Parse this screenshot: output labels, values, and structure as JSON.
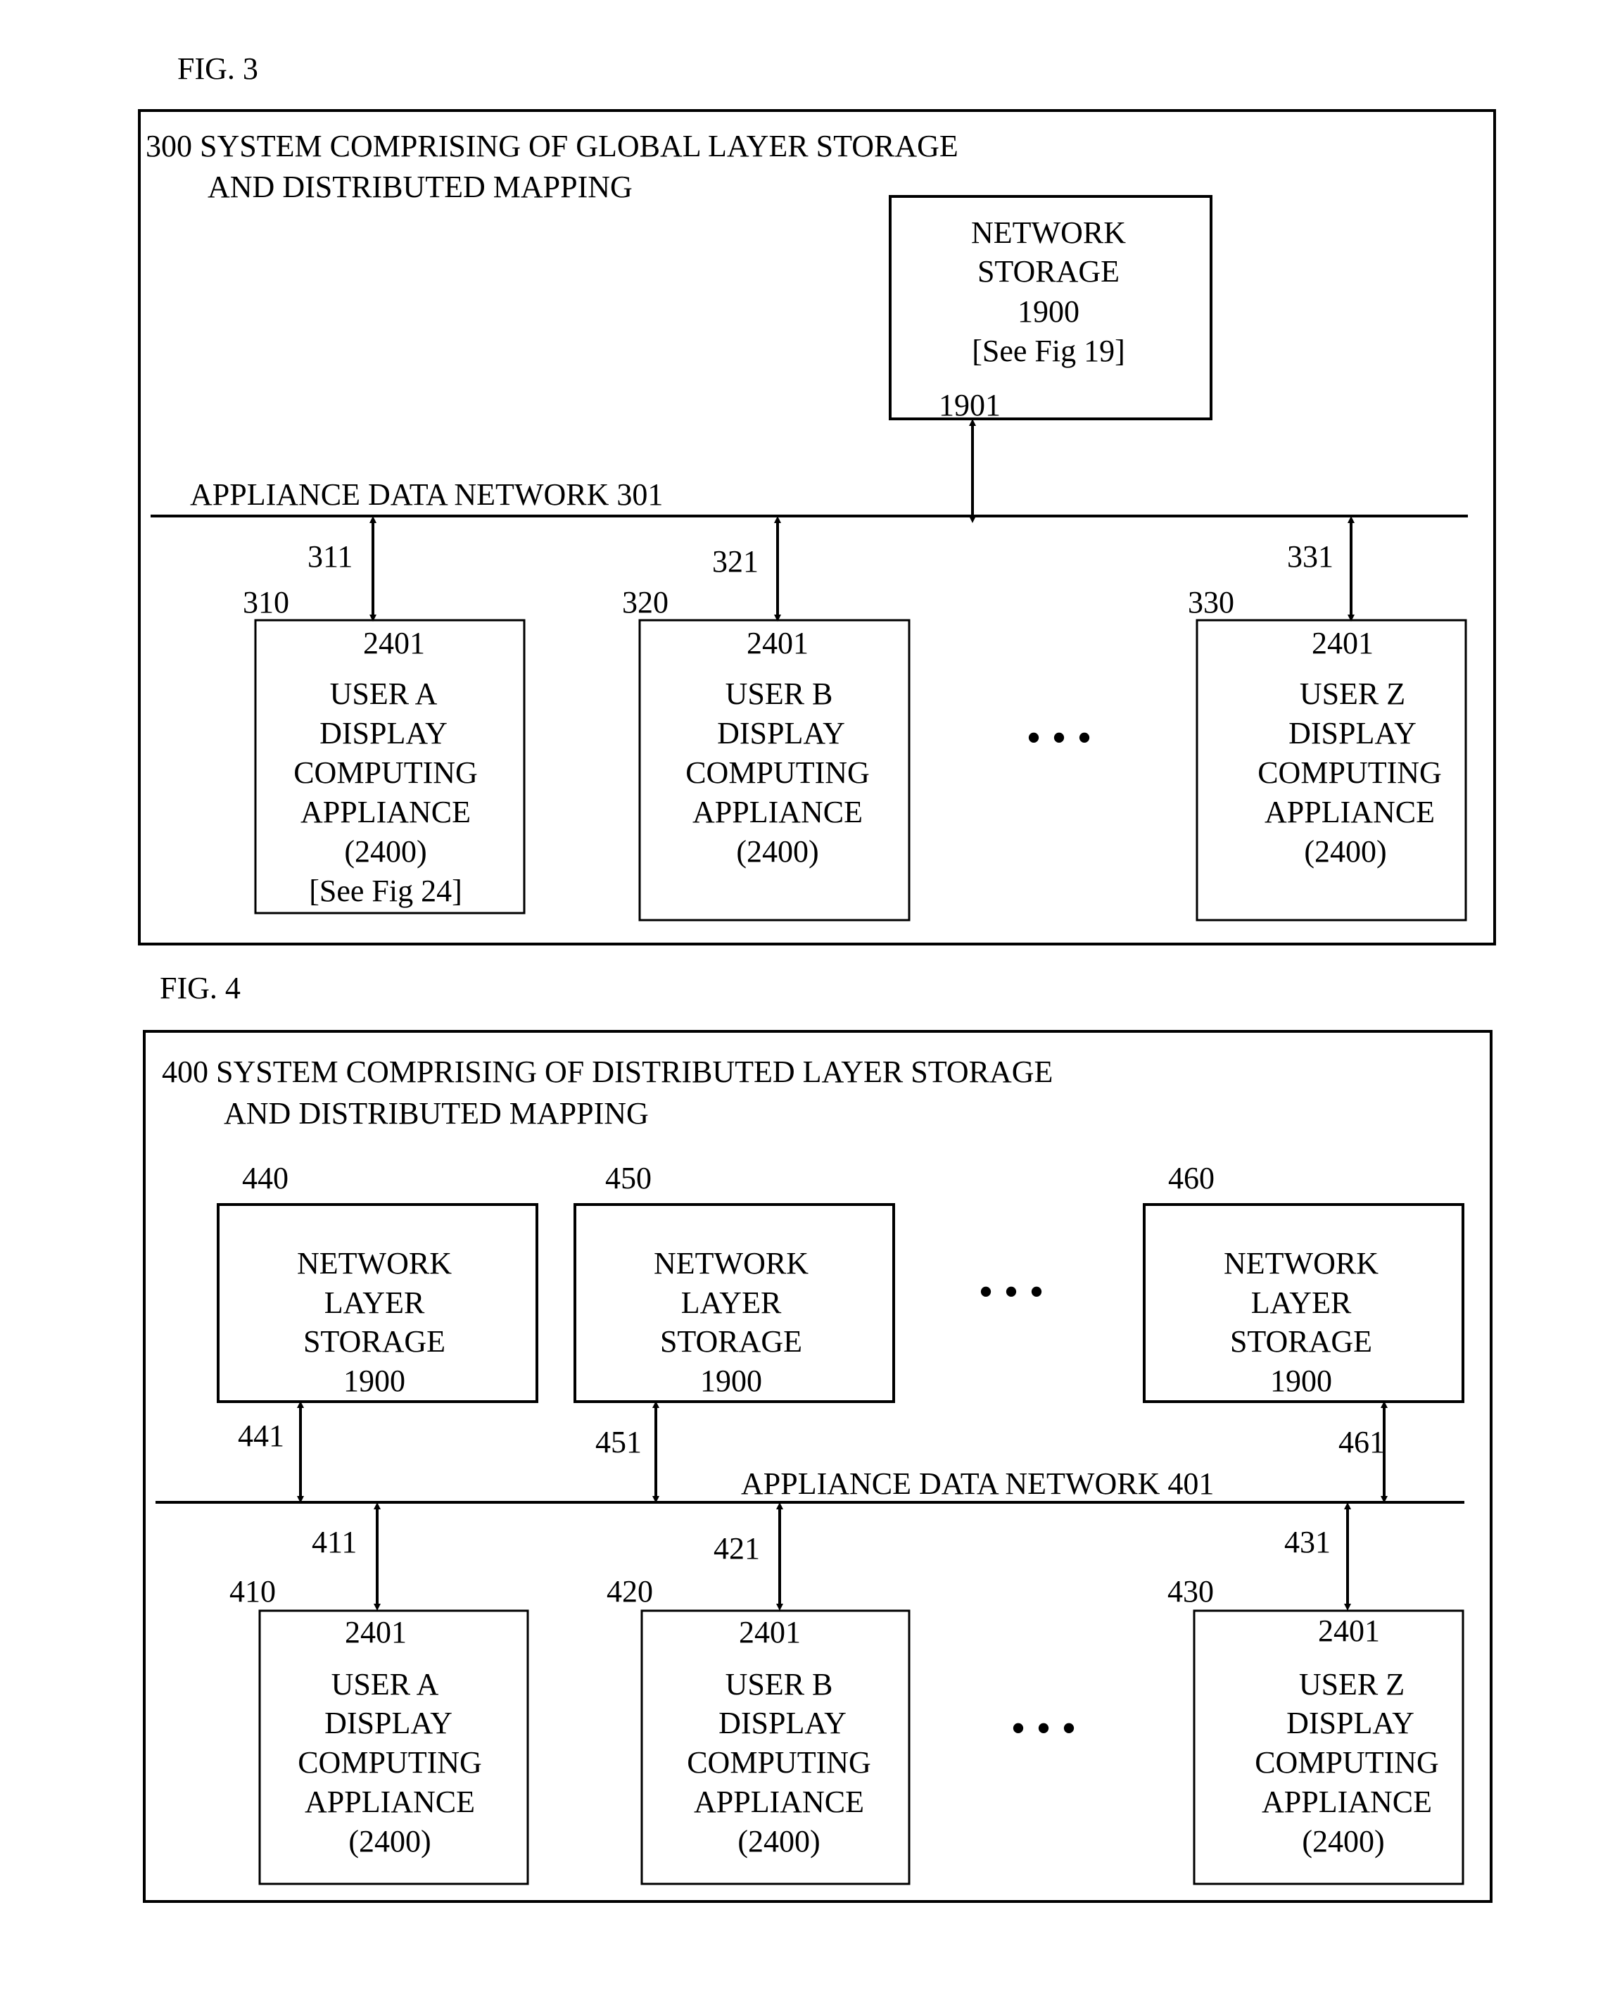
{
  "fig3": {
    "caption": "FIG. 3",
    "title_line1": "300 SYSTEM COMPRISING OF GLOBAL LAYER STORAGE",
    "title_line2": "AND DISTRIBUTED MAPPING",
    "network_label": "APPLIANCE DATA NETWORK 301",
    "storage": {
      "lines": [
        "NETWORK",
        "STORAGE",
        "1900",
        "[See Fig 19]"
      ],
      "link_ref": "1901"
    },
    "appliances": [
      {
        "ref": "310",
        "link_ref": "311",
        "top_ref": "2401",
        "lines": [
          "USER A",
          "DISPLAY",
          "COMPUTING",
          "APPLIANCE",
          "(2400)",
          "[See Fig 24]"
        ]
      },
      {
        "ref": "320",
        "link_ref": "321",
        "top_ref": "2401",
        "lines": [
          "USER B",
          "DISPLAY",
          "COMPUTING",
          "APPLIANCE",
          "(2400)"
        ]
      },
      {
        "ref": "330",
        "link_ref": "331",
        "top_ref": "2401",
        "lines": [
          "USER Z",
          "DISPLAY",
          "COMPUTING",
          "APPLIANCE",
          "(2400)"
        ]
      }
    ],
    "ellipsis": "• • •"
  },
  "fig4": {
    "caption": "FIG. 4",
    "title_line1": "400 SYSTEM COMPRISING OF DISTRIBUTED LAYER STORAGE",
    "title_line2": "AND DISTRIBUTED MAPPING",
    "network_label": "APPLIANCE DATA NETWORK 401",
    "storages": [
      {
        "ref": "440",
        "link_ref": "441",
        "lines": [
          "NETWORK",
          "LAYER",
          "STORAGE",
          "1900"
        ]
      },
      {
        "ref": "450",
        "link_ref": "451",
        "lines": [
          "NETWORK",
          "LAYER",
          "STORAGE",
          "1900"
        ]
      },
      {
        "ref": "460",
        "link_ref": "461",
        "lines": [
          "NETWORK",
          "LAYER",
          "STORAGE",
          "1900"
        ]
      }
    ],
    "appliances": [
      {
        "ref": "410",
        "link_ref": "411",
        "top_ref": "2401",
        "lines": [
          "USER A",
          "DISPLAY",
          "COMPUTING",
          "APPLIANCE",
          "(2400)"
        ]
      },
      {
        "ref": "420",
        "link_ref": "421",
        "top_ref": "2401",
        "lines": [
          "USER B",
          "DISPLAY",
          "COMPUTING",
          "APPLIANCE",
          "(2400)"
        ]
      },
      {
        "ref": "430",
        "link_ref": "431",
        "top_ref": "2401",
        "lines": [
          "USER Z",
          "DISPLAY",
          "COMPUTING",
          "APPLIANCE",
          "(2400)"
        ]
      }
    ],
    "ellipsis_top": "• • •",
    "ellipsis_bottom": "• • •"
  }
}
